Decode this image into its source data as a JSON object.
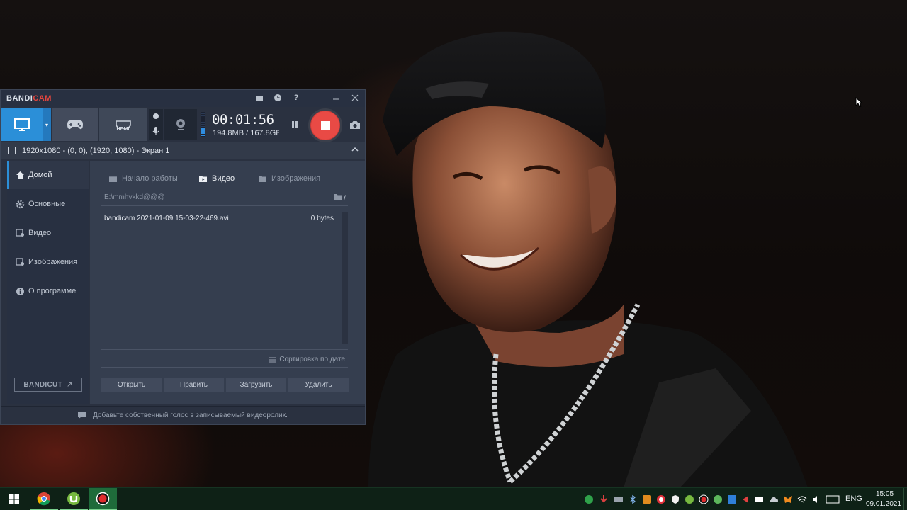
{
  "colors": {
    "accent": "#2b8fd8",
    "record": "#e94a45",
    "window_bg": "#2a3140",
    "panel_bg": "#353e4f",
    "taskbar_bg": "#0e2116",
    "taskbar_active": "#1f6b3a"
  },
  "bandicam": {
    "logo": {
      "main": "BANDI",
      "accent": "CAM"
    },
    "titlebar_buttons": [
      "folder-icon",
      "clock-icon",
      "help-icon",
      "minimize-icon",
      "close-icon"
    ],
    "titlebar_labels": {
      "help": "?"
    },
    "modes": [
      "screen-mode-icon",
      "game-mode-icon",
      "hdmi-mode-icon"
    ],
    "hdmi_label": "HDMI",
    "timer": "00:01:56",
    "size": "194.8MB / 167.8GB",
    "audio_level": 0.35,
    "target": "1920x1080 - (0, 0), (1920, 1080) - Экран 1",
    "sidebar": [
      {
        "label": "Домой",
        "icon": "home-icon"
      },
      {
        "label": "Основные",
        "icon": "gear-icon"
      },
      {
        "label": "Видео",
        "icon": "video-icon"
      },
      {
        "label": "Изображения",
        "icon": "image-icon"
      },
      {
        "label": "О программе",
        "icon": "info-icon"
      }
    ],
    "bandicut": {
      "main": "BANDICUT",
      "arrow": "↗"
    },
    "subtabs": [
      {
        "label": "Начало работы",
        "icon": "clapper-icon"
      },
      {
        "label": "Видео",
        "icon": "folder-icon"
      },
      {
        "label": "Изображения",
        "icon": "image-icon"
      }
    ],
    "path": "E:\\mmhvkkd@@@",
    "path_slash": "/",
    "files": [
      {
        "name": "bandicam 2021-01-09 15-03-22-469.avi",
        "size": "0 bytes"
      }
    ],
    "sort_label": "Сортировка по дате",
    "actions": [
      "Открыть",
      "Править",
      "Загрузить",
      "Удалить"
    ],
    "status": "Добавьте собственный голос в записываемый видеоролик."
  },
  "taskbar": {
    "apps": [
      "windows-start-icon",
      "chrome-icon",
      "utorrent-icon",
      "bandicam-record-icon"
    ],
    "tray_icons": [
      "kaspersky-icon",
      "download-icon",
      "printer-icon",
      "bluetooth-icon",
      "app-icon",
      "opera-icon",
      "shield-icon",
      "utorrent-tray-icon",
      "record-tray-icon",
      "tray-app-icon",
      "tray-app2-icon",
      "sound-flag-icon",
      "battery-icon",
      "cloud-icon",
      "metamask-icon",
      "wifi-icon",
      "volume-icon",
      "keyboard-icon"
    ],
    "lang": "ENG",
    "time": "15:05",
    "date": "09.01.2021"
  }
}
